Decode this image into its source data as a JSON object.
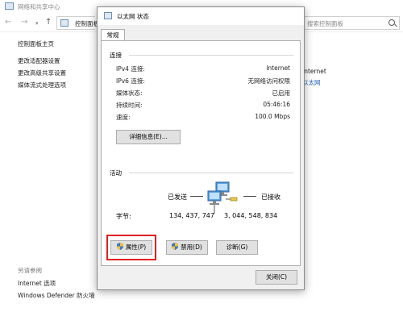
{
  "background_window": {
    "title": "网络和共享中心",
    "address": "控制面板",
    "search_placeholder": "搜索控制面板",
    "sidebar": {
      "home": "控制面板主页",
      "links": [
        "更改适配器设置",
        "更改高级共享设置",
        "媒体流式处理选项"
      ],
      "see_also": "另请参阅",
      "bottom_links": [
        "Internet 选项",
        "Windows Defender 防火墙"
      ]
    },
    "main": {
      "access_type": "Internet",
      "connection": "以太网"
    }
  },
  "dialog": {
    "title": "以太网 状态",
    "tab": "常规",
    "connection_section": "连接",
    "rows": [
      {
        "label": "IPv4 连接:",
        "value": "Internet"
      },
      {
        "label": "IPv6 连接:",
        "value": "无网络访问权限"
      },
      {
        "label": "媒体状态:",
        "value": "已启用"
      },
      {
        "label": "持续时间:",
        "value": "05:46:16"
      },
      {
        "label": "速度:",
        "value": "100.0 Mbps"
      }
    ],
    "details_button": "详细信息(E)...",
    "activity_section": "活动",
    "sent_label": "已发送",
    "received_label": "已接收",
    "bytes_label": "字节:",
    "sent_bytes": "134, 437, 747",
    "received_bytes": "3, 044, 548, 834",
    "properties_button": "属性(P)",
    "disable_button": "禁用(D)",
    "diagnose_button": "诊断(G)",
    "close_button": "关闭(C)"
  }
}
